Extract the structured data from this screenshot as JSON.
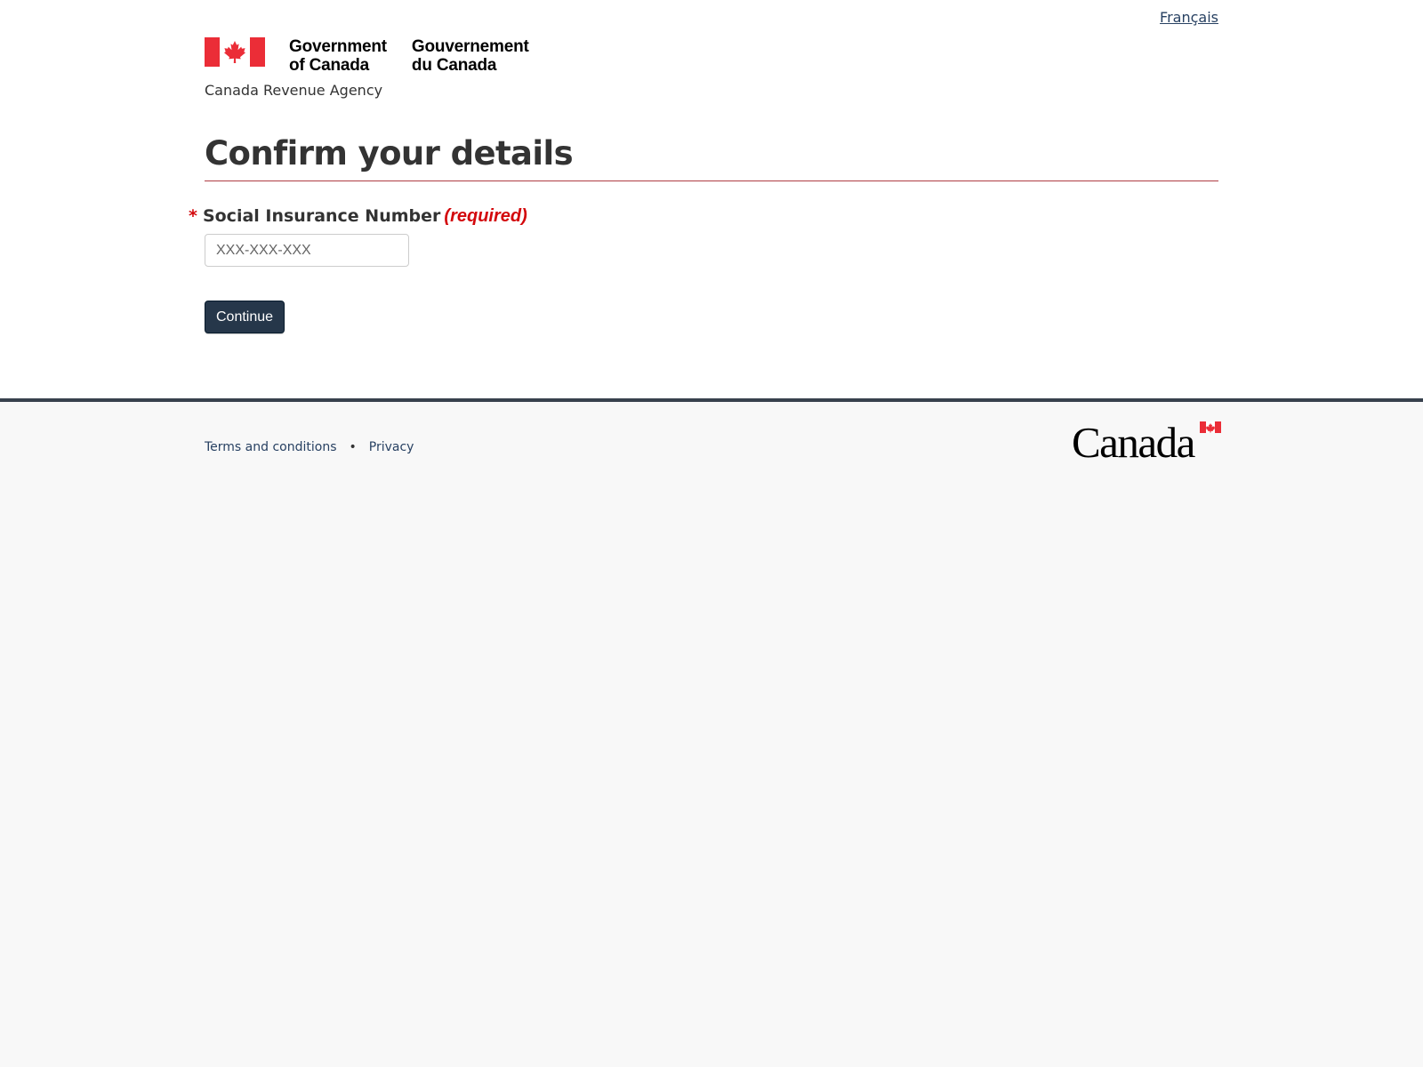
{
  "header": {
    "language_link": "Français",
    "signature_en_line1": "Government",
    "signature_en_line2": "of Canada",
    "signature_fr_line1": "Gouvernement",
    "signature_fr_line2": "du Canada",
    "agency": "Canada Revenue Agency"
  },
  "main": {
    "title": "Confirm your details",
    "sin_field": {
      "asterisk": "*",
      "label": "Social Insurance Number",
      "required_text": "(required)",
      "placeholder": "XXX-XXX-XXX",
      "value": ""
    },
    "continue_label": "Continue"
  },
  "footer": {
    "links": [
      "Terms and conditions",
      "Privacy"
    ],
    "separator": "•",
    "wordmark_text": "Canada"
  },
  "colors": {
    "flag_red": "#eb2d37",
    "button_bg": "#26374a",
    "link": "#284162",
    "title_rule": "#af3c43",
    "required_red": "#d3080c",
    "footer_bar": "#38414d"
  },
  "icons": {
    "flag": "canada-flag-icon",
    "wordmark_flag": "canada-wordmark-flag-icon"
  }
}
